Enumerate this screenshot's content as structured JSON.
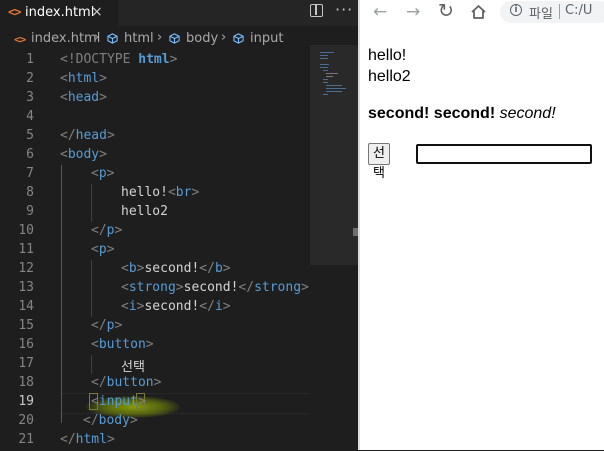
{
  "editor": {
    "tab": {
      "icon": "html-file-icon",
      "label": "index.html",
      "close": "×"
    },
    "actions": {
      "split": "split-editor-icon",
      "more": "···"
    },
    "breadcrumb": [
      "index.html",
      "html",
      "body",
      "input"
    ],
    "active_line": 19,
    "line_numbers": [
      "1",
      "2",
      "3",
      "4",
      "5",
      "6",
      "7",
      "8",
      "9",
      "10",
      "11",
      "12",
      "13",
      "14",
      "15",
      "16",
      "17",
      "18",
      "19",
      "20",
      "21"
    ],
    "lines": {
      "l1_a": "<!DOCTYPE ",
      "l1_b": "html",
      "l1_c": ">",
      "l2_a": "<",
      "l2_b": "html",
      "l2_c": ">",
      "l3_a": "<",
      "l3_b": "head",
      "l3_c": ">",
      "l5_a": "</",
      "l5_b": "head",
      "l5_c": ">",
      "l6_a": "<",
      "l6_b": "body",
      "l6_c": ">",
      "l7_a": "<",
      "l7_b": "p",
      "l7_c": ">",
      "l8_text": "hello!",
      "l8_a": "<",
      "l8_b": "br",
      "l8_c": ">",
      "l9_text": "hello2",
      "l10_a": "</",
      "l10_b": "p",
      "l10_c": ">",
      "l11_a": "<",
      "l11_b": "p",
      "l11_c": ">",
      "l12_a": "<",
      "l12_b": "b",
      "l12_c": ">",
      "l12_text": "second!",
      "l12_d": "</",
      "l12_e": "b",
      "l12_f": ">",
      "l13_a": "<",
      "l13_b": "strong",
      "l13_c": ">",
      "l13_text": "second!",
      "l13_d": "</",
      "l13_e": "strong",
      "l13_f": ">",
      "l14_a": "<",
      "l14_b": "i",
      "l14_c": ">",
      "l14_text": "second!",
      "l14_d": "</",
      "l14_e": "i",
      "l14_f": ">",
      "l15_a": "</",
      "l15_b": "p",
      "l15_c": ">",
      "l16_a": "<",
      "l16_b": "button",
      "l16_c": ">",
      "l17_text": "선택",
      "l18_a": "</",
      "l18_b": "button",
      "l18_c": ">",
      "l19_a": "<",
      "l19_b": "input",
      "l19_c": ">",
      "l20_a": "</",
      "l20_b": "body",
      "l20_c": ">",
      "l21_a": "</",
      "l21_b": "html",
      "l21_c": ">"
    },
    "colors": {
      "background": "#1e1e1e",
      "tag": "#569cd6",
      "bracket": "#808080",
      "text": "#d4d4d4",
      "highlight": "#aacc00"
    }
  },
  "browser": {
    "nav": {
      "back": "←",
      "forward": "→",
      "reload": "↻",
      "home": "home-icon"
    },
    "address": {
      "info": "i",
      "label": "파일",
      "url": "C:/U"
    },
    "page": {
      "line1": "hello!",
      "line2": "hello2",
      "bold": "second!",
      "strong": "second!",
      "italic": "second!",
      "button_label": "선택",
      "input_value": ""
    }
  }
}
